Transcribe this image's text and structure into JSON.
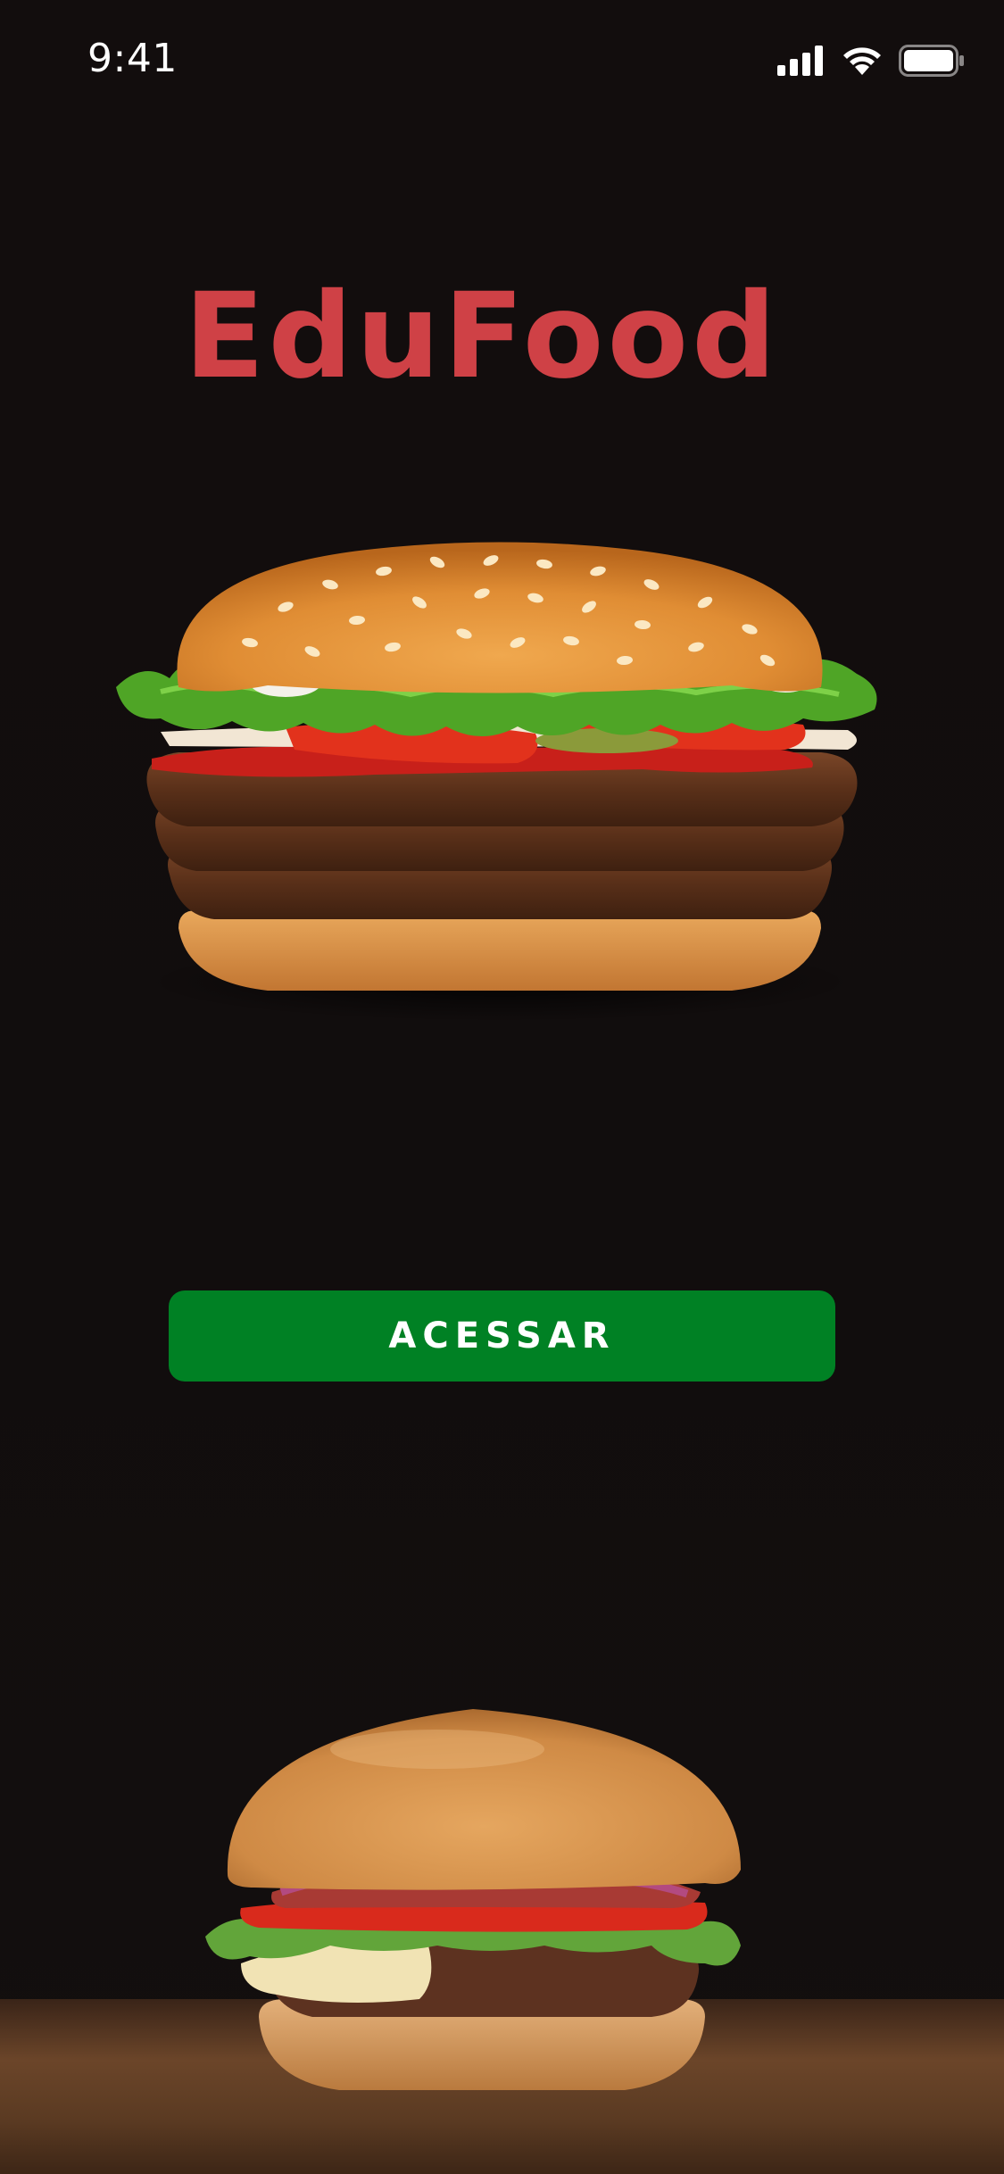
{
  "status_bar": {
    "time": "9:41",
    "icons": [
      "signal-icon",
      "wifi-icon",
      "battery-icon"
    ]
  },
  "app": {
    "title": "EduFood"
  },
  "main": {
    "cta_label": "ACESSAR"
  },
  "images": {
    "hero": "triple-patty-burger-image",
    "footer": "cheeseburger-image"
  },
  "colors": {
    "background": "#110d0d",
    "title": "#cf4146",
    "button": "#008124",
    "button_text": "#ffffff"
  }
}
